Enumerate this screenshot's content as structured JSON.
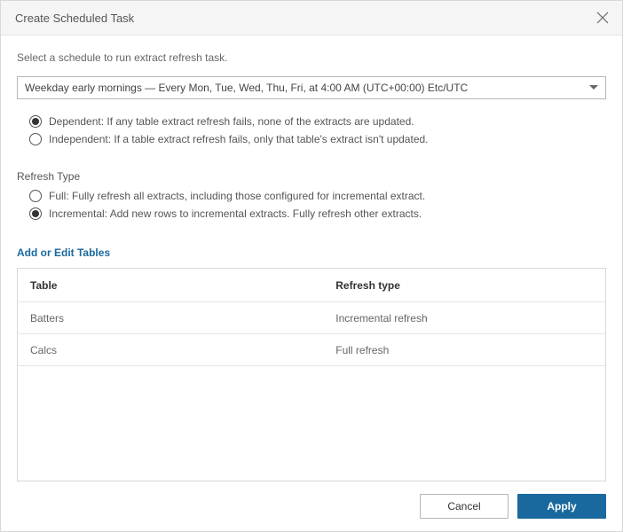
{
  "dialog": {
    "title": "Create Scheduled Task",
    "instruction": "Select a schedule to run extract refresh task."
  },
  "schedule": {
    "selected": "Weekday early mornings — Every Mon, Tue, Wed, Thu, Fri, at 4:00 AM (UTC+00:00) Etc/UTC"
  },
  "dependency": {
    "options": [
      {
        "label": "Dependent: If any table extract refresh fails, none of the extracts are updated.",
        "selected": true
      },
      {
        "label": "Independent: If a table extract refresh fails, only that table's extract isn't updated.",
        "selected": false
      }
    ]
  },
  "refresh_type": {
    "heading": "Refresh Type",
    "options": [
      {
        "label": "Full: Fully refresh all extracts, including those configured for incremental extract.",
        "selected": false
      },
      {
        "label": "Incremental: Add new rows to incremental extracts. Fully refresh other extracts.",
        "selected": true
      }
    ]
  },
  "tables": {
    "link_label": "Add or Edit Tables",
    "headers": {
      "table": "Table",
      "type": "Refresh type"
    },
    "rows": [
      {
        "name": "Batters",
        "type": "Incremental refresh"
      },
      {
        "name": "Calcs",
        "type": "Full refresh"
      }
    ]
  },
  "footer": {
    "cancel": "Cancel",
    "apply": "Apply"
  }
}
